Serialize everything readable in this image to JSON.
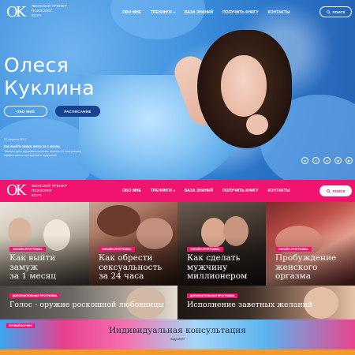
{
  "brand": {
    "logo_mark": "OK",
    "tagline_lines": [
      "Женский тренер",
      "Психолог",
      "Коуч"
    ]
  },
  "nav": {
    "items": [
      {
        "label": "Обо мне"
      },
      {
        "label": "Тренинги",
        "has_dropdown": true
      },
      {
        "label": "База знаний"
      },
      {
        "label": "Получить книгу"
      },
      {
        "label": "Контакты"
      }
    ],
    "search_label": "Поиск"
  },
  "hero": {
    "title_line1": "Олеся",
    "title_line2": "Куклина",
    "about_button": "Обо мне",
    "schedule_button": "Расписание",
    "news_date": "21 апреля 2017",
    "news_title": "Как выйти замуж легко за 1 месяц",
    "news_text": "Тренинг дает фундаментальные знания по построению эффективных отношений с мужчиной",
    "socials": [
      "vk-icon",
      "facebook-icon",
      "odnoklassniki-icon",
      "instagram-icon",
      "youtube-icon"
    ]
  },
  "cards": [
    {
      "tag": "Онлайн-программа",
      "title_lines": [
        "Как выйти",
        "замуж",
        "за 1 месяц"
      ]
    },
    {
      "tag": "Онлайн-программа",
      "title_lines": [
        "Как обрести",
        "сексуальность",
        "за 24 часа"
      ]
    },
    {
      "tag": "Онлайн-программа",
      "title_lines": [
        "Как сделать",
        "мужчину",
        "миллионером"
      ]
    },
    {
      "tag": "Онлайн-программа",
      "title_lines": [
        "Пробуждение",
        "женского",
        "оргазма"
      ]
    }
  ],
  "wide_cards": [
    {
      "tag": "Дополнительная программа",
      "title": "Голос - оружие роскошной любовницы"
    },
    {
      "tag": "Дополнительная программа",
      "title": "Исполнение заветных желаний"
    }
  ],
  "banner": {
    "tag": "Личный коучинг",
    "title": "Индивидуальная консультация",
    "subtitle": "Подробнее"
  },
  "colors": {
    "accent": "#f0146e",
    "hero_blue": "#3e8fdd",
    "button_dark_blue": "#17428f"
  }
}
